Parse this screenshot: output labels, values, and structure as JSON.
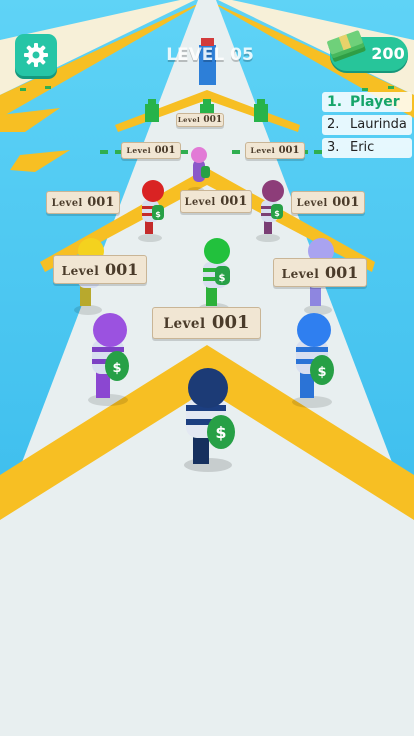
{
  "hud": {
    "level_title": "LEVEL 05",
    "money": "200"
  },
  "leaderboard": [
    {
      "rank": "1.",
      "name": "Player"
    },
    {
      "rank": "2.",
      "name": "Laurinda"
    },
    {
      "rank": "3.",
      "name": "Eric"
    }
  ],
  "signs": {
    "word": "Level",
    "number": "001"
  },
  "colors": {
    "sky": "#3fc3f0",
    "track": "#e8eff0",
    "stripe": "#f7bf23",
    "hud_green": "#26c5a6",
    "leader_green": "#16a56a"
  },
  "icons": {
    "settings": "gear-icon",
    "money": "cash-stack-icon",
    "bag": "money-bag-icon"
  }
}
